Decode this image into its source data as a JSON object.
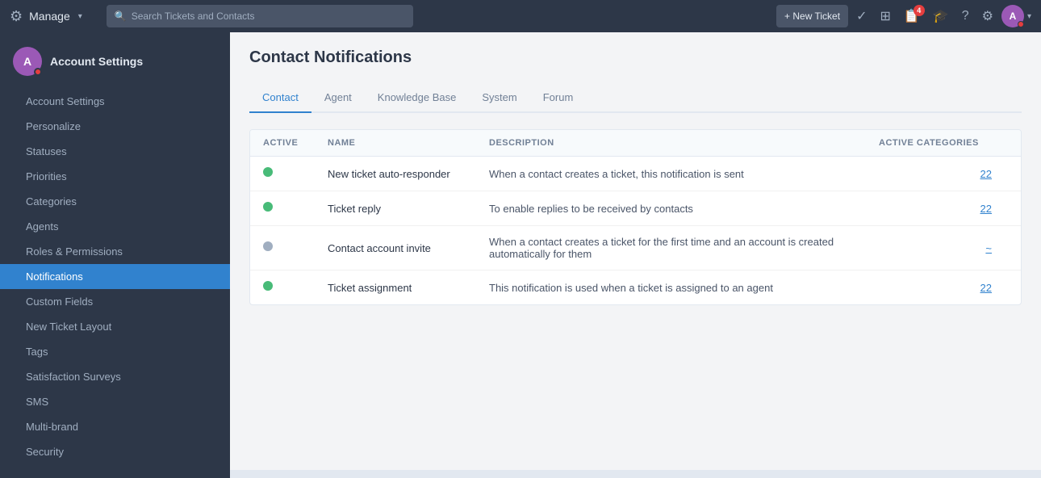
{
  "topbar": {
    "logo_icon": "⚙",
    "app_name": "Manage",
    "search_placeholder": "Search Tickets and Contacts",
    "new_ticket_label": "+ New Ticket",
    "notification_count": "4"
  },
  "sidebar": {
    "avatar_letter": "A",
    "account_settings_label": "Account Settings",
    "items": [
      {
        "id": "account-settings",
        "label": "Account Settings",
        "active": false
      },
      {
        "id": "personalize",
        "label": "Personalize",
        "active": false
      },
      {
        "id": "statuses",
        "label": "Statuses",
        "active": false
      },
      {
        "id": "priorities",
        "label": "Priorities",
        "active": false
      },
      {
        "id": "categories",
        "label": "Categories",
        "active": false
      },
      {
        "id": "agents",
        "label": "Agents",
        "active": false
      },
      {
        "id": "roles-permissions",
        "label": "Roles & Permissions",
        "active": false
      },
      {
        "id": "notifications",
        "label": "Notifications",
        "active": true
      },
      {
        "id": "custom-fields",
        "label": "Custom Fields",
        "active": false
      },
      {
        "id": "new-ticket-layout",
        "label": "New Ticket Layout",
        "active": false
      },
      {
        "id": "tags",
        "label": "Tags",
        "active": false
      },
      {
        "id": "satisfaction-surveys",
        "label": "Satisfaction Surveys",
        "active": false
      },
      {
        "id": "sms",
        "label": "SMS",
        "active": false
      },
      {
        "id": "multi-brand",
        "label": "Multi-brand",
        "active": false
      },
      {
        "id": "security",
        "label": "Security",
        "active": false
      }
    ]
  },
  "content": {
    "page_title": "Contact Notifications",
    "tabs": [
      {
        "id": "contact",
        "label": "Contact",
        "active": true
      },
      {
        "id": "agent",
        "label": "Agent",
        "active": false
      },
      {
        "id": "knowledge-base",
        "label": "Knowledge Base",
        "active": false
      },
      {
        "id": "system",
        "label": "System",
        "active": false
      },
      {
        "id": "forum",
        "label": "Forum",
        "active": false
      }
    ],
    "table": {
      "headers": [
        "ACTIVE",
        "NAME",
        "DESCRIPTION",
        "ACTIVE CATEGORIES"
      ],
      "rows": [
        {
          "active": true,
          "name": "New ticket auto-responder",
          "description": "When a contact creates a ticket, this notification is sent",
          "count": "22"
        },
        {
          "active": true,
          "name": "Ticket reply",
          "description": "To enable replies to be received by contacts",
          "count": "22"
        },
        {
          "active": false,
          "name": "Contact account invite",
          "description": "When a contact creates a ticket for the first time and an account is created automatically for them",
          "count": "~"
        },
        {
          "active": true,
          "name": "Ticket assignment",
          "description": "This notification is used when a ticket is assigned to an agent",
          "count": "22"
        }
      ]
    }
  }
}
